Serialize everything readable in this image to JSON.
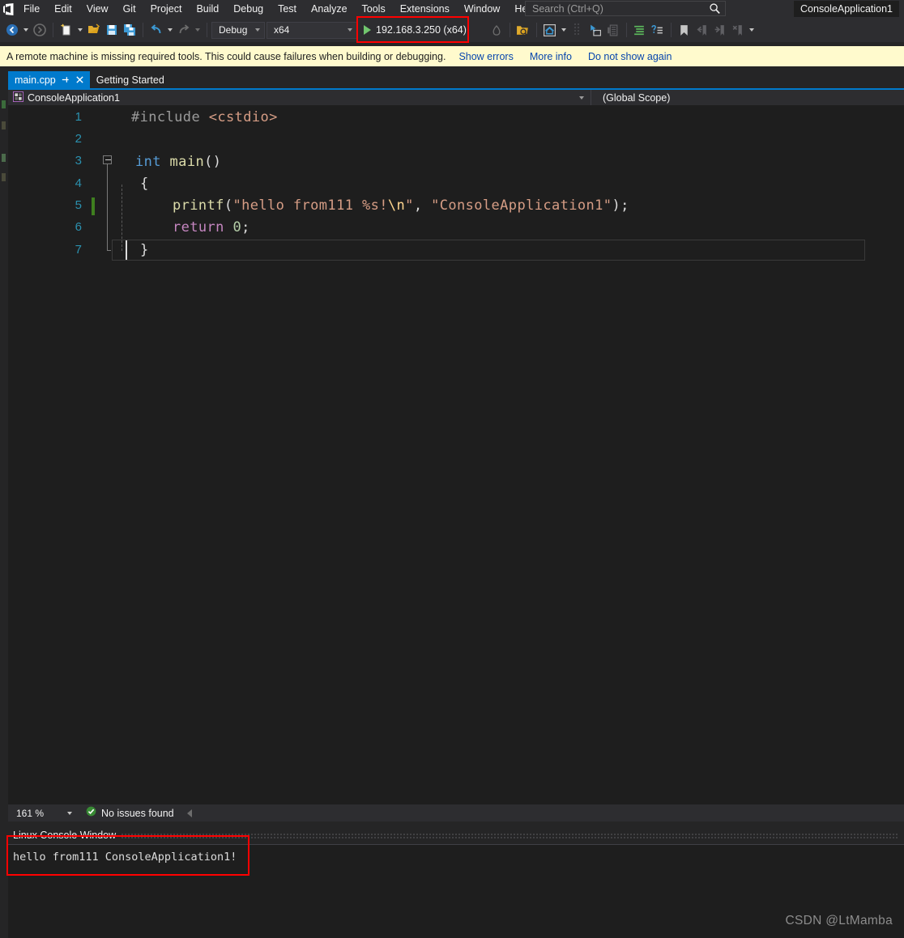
{
  "window": {
    "app_title": "ConsoleApplication1"
  },
  "menu": {
    "items": [
      {
        "label": "File"
      },
      {
        "label": "Edit"
      },
      {
        "label": "View"
      },
      {
        "label": "Git"
      },
      {
        "label": "Project"
      },
      {
        "label": "Build"
      },
      {
        "label": "Debug"
      },
      {
        "label": "Test"
      },
      {
        "label": "Analyze"
      },
      {
        "label": "Tools"
      },
      {
        "label": "Extensions"
      },
      {
        "label": "Window"
      },
      {
        "label": "Help"
      }
    ]
  },
  "search": {
    "placeholder": "Search (Ctrl+Q)",
    "icon": "search-icon"
  },
  "toolbar": {
    "icons": [
      "navigate-backward-icon",
      "navigate-forward-icon",
      "new-project-icon",
      "open-file-icon",
      "save-icon",
      "save-all-icon",
      "undo-icon",
      "redo-icon"
    ],
    "configuration": "Debug",
    "platform": "x64",
    "start_target": "192.168.3.250 (x64)",
    "start_icon": "play-icon",
    "right_icons": [
      "live-share-icon",
      "solution-explorer-search-icon",
      "home-icon",
      "pointer-select-icon",
      "copy-lines-icon",
      "comment-icon",
      "uncomment-icon",
      "bookmark-icon",
      "prev-bookmark-icon",
      "next-bookmark-icon",
      "clear-bookmarks-icon",
      "overflow-icon"
    ]
  },
  "notification": {
    "message": "A remote machine is missing required tools. This could cause failures when building or debugging.",
    "links": [
      "Show errors",
      "More info",
      "Do not show again"
    ]
  },
  "tabs": [
    {
      "label": "main.cpp",
      "active": true,
      "pin_icon": "pin-icon",
      "close_icon": "close-icon"
    },
    {
      "label": "Getting Started",
      "active": false
    }
  ],
  "navbar": {
    "project": "ConsoleApplication1",
    "project_icon": "cpp-project-icon",
    "scope": "(Global Scope)"
  },
  "editor": {
    "line_numbers": [
      "1",
      "2",
      "3",
      "4",
      "5",
      "6",
      "7"
    ],
    "code": {
      "line1": {
        "pre": "#include",
        "space": " ",
        "include": "<cstdio>"
      },
      "line3": {
        "kw": "int",
        "space": " ",
        "fn": "main",
        "punct": "()"
      },
      "line4": {
        "punct": "{"
      },
      "line5": {
        "fn": "printf",
        "open": "(",
        "str1": "\"hello from111 %s!",
        "esc": "\\n",
        "str1end": "\"",
        "comma": ", ",
        "str2": "\"ConsoleApplication1\"",
        "close": ");"
      },
      "line6": {
        "ret": "return",
        "space": " ",
        "num": "0",
        "semi": ";"
      },
      "line7": {
        "punct": "}"
      }
    }
  },
  "statusbar": {
    "zoom": "161 %",
    "issues_text": "No issues found",
    "issues_icon": "check-circle-icon"
  },
  "panel": {
    "title": "Linux Console Window",
    "console_output": "hello from111 ConsoleApplication1!"
  },
  "watermark": "CSDN @LtMamba",
  "colors": {
    "accent": "#007acc",
    "notification_bg": "#fffacd",
    "highlight_outline": "#ff0000",
    "chrome_bg": "#2d2d30",
    "editor_bg": "#1e1e1e",
    "link": "#0645ad",
    "ok_green": "#388a34",
    "play_green": "#71c66e"
  }
}
